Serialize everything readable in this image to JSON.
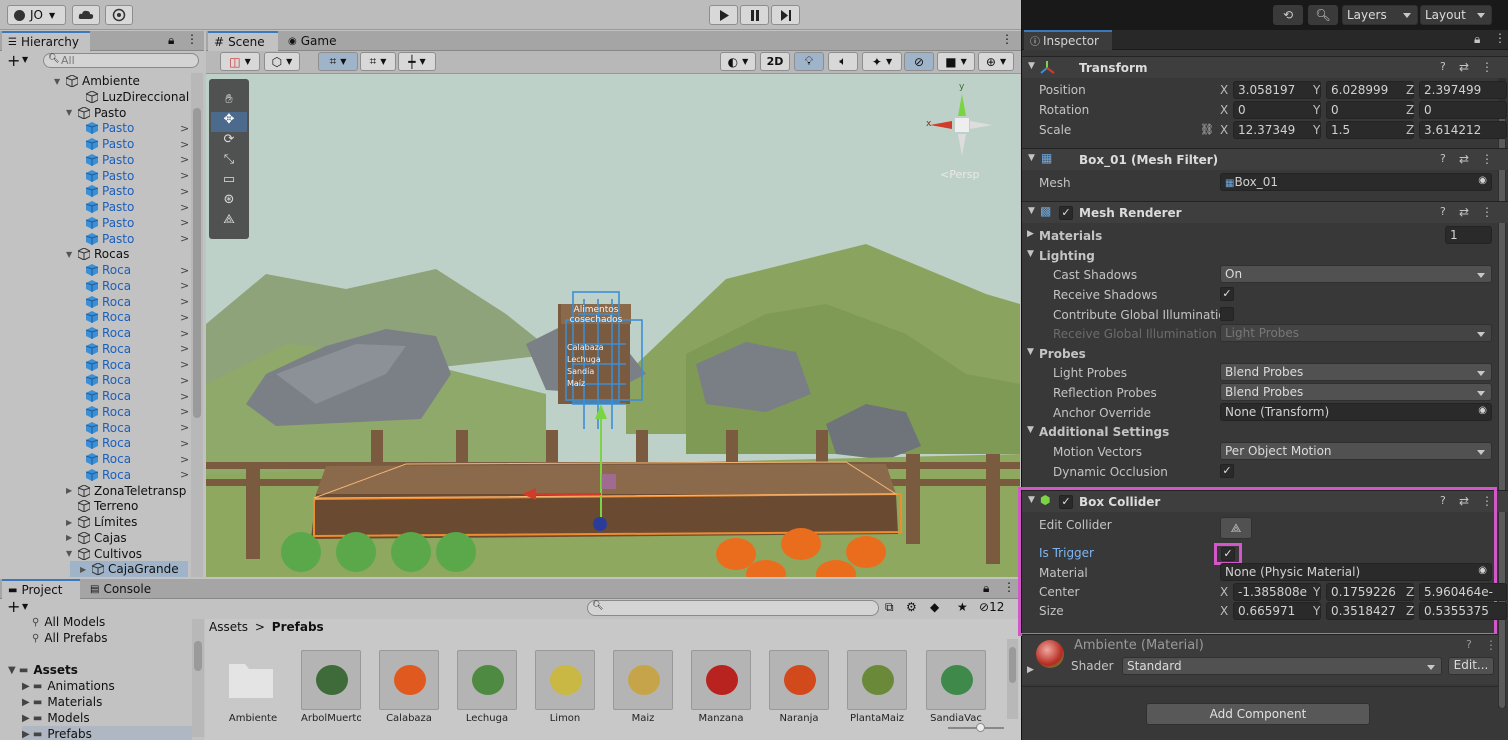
{
  "toolbar": {
    "account": "JO",
    "play_icon": "play-icon",
    "pause_icon": "pause-icon",
    "step_icon": "step-icon",
    "history_icon": "history-icon",
    "search_icon": "search-icon",
    "layers": "Layers",
    "layout": "Layout"
  },
  "hierarchy": {
    "tab": "Hierarchy",
    "search_placeholder": "All",
    "items": [
      {
        "label": "Ambiente",
        "blue": false
      },
      {
        "label": "LuzDireccional",
        "blue": false
      },
      {
        "label": "Pasto",
        "blue": false
      },
      {
        "label": "Pasto",
        "blue": true
      },
      {
        "label": "Pasto",
        "blue": true
      },
      {
        "label": "Pasto",
        "blue": true
      },
      {
        "label": "Pasto",
        "blue": true
      },
      {
        "label": "Pasto",
        "blue": true
      },
      {
        "label": "Pasto",
        "blue": true
      },
      {
        "label": "Pasto",
        "blue": true
      },
      {
        "label": "Pasto",
        "blue": true
      },
      {
        "label": "Rocas",
        "blue": false
      },
      {
        "label": "Roca",
        "blue": true
      },
      {
        "label": "Roca",
        "blue": true
      },
      {
        "label": "Roca",
        "blue": true
      },
      {
        "label": "Roca",
        "blue": true
      },
      {
        "label": "Roca",
        "blue": true
      },
      {
        "label": "Roca",
        "blue": true
      },
      {
        "label": "Roca",
        "blue": true
      },
      {
        "label": "Roca",
        "blue": true
      },
      {
        "label": "Roca",
        "blue": true
      },
      {
        "label": "Roca",
        "blue": true
      },
      {
        "label": "Roca",
        "blue": true
      },
      {
        "label": "Roca",
        "blue": true
      },
      {
        "label": "Roca",
        "blue": true
      },
      {
        "label": "Roca",
        "blue": true
      },
      {
        "label": "ZonaTeletransp",
        "blue": false
      },
      {
        "label": "Terreno",
        "blue": false
      },
      {
        "label": "Límites",
        "blue": false
      },
      {
        "label": "Cajas",
        "blue": false
      },
      {
        "label": "Cultivos",
        "blue": false
      },
      {
        "label": "CajaGrande",
        "blue": false
      }
    ]
  },
  "scene": {
    "tab_scene": "Scene",
    "tab_game": "Game",
    "mode_2d": "2D",
    "persp": "<Persp",
    "gizmo_x": "x",
    "gizmo_y": "y",
    "sign_lines": [
      "Alimentos",
      "cosechados",
      "Calabaza",
      "Lechuga",
      "Sandía",
      "Maíz"
    ]
  },
  "project": {
    "tab_project": "Project",
    "tab_console": "Console",
    "tree": [
      {
        "label": "All Models",
        "kind": "search"
      },
      {
        "label": "All Prefabs",
        "kind": "search"
      },
      {
        "label": "Assets",
        "kind": "root"
      },
      {
        "label": "Animations",
        "kind": "folder"
      },
      {
        "label": "Materials",
        "kind": "folder"
      },
      {
        "label": "Models",
        "kind": "folder"
      },
      {
        "label": "Prefabs",
        "kind": "folder"
      }
    ],
    "breadcrumb_root": "Assets",
    "breadcrumb_leaf": "Prefabs",
    "hidden_count": "12",
    "assets": [
      "Ambiente",
      "ArbolMuerto",
      "Calabaza",
      "Lechuga",
      "Limon",
      "Maiz",
      "Manzana",
      "Naranja",
      "PlantaMaiz",
      "SandiaVac"
    ]
  },
  "inspector": {
    "tab": "Inspector",
    "transform": {
      "title": "Transform",
      "position": {
        "label": "Position",
        "x": "3.058197",
        "y": "6.028999",
        "z": "2.397499"
      },
      "rotation": {
        "label": "Rotation",
        "x": "0",
        "y": "0",
        "z": "0"
      },
      "scale": {
        "label": "Scale",
        "x": "12.37349",
        "y": "1.5",
        "z": "3.614212"
      }
    },
    "mesh_filter": {
      "title": "Box_01 (Mesh Filter)",
      "mesh_label": "Mesh",
      "mesh_value": "Box_01"
    },
    "mesh_renderer": {
      "title": "Mesh Renderer",
      "materials_label": "Materials",
      "materials_count": "1",
      "lighting": "Lighting",
      "cast_shadows_label": "Cast Shadows",
      "cast_shadows": "On",
      "receive_shadows_label": "Receive Shadows",
      "contribute_gi_label": "Contribute Global Illumination",
      "receive_gi_label": "Receive Global Illumination",
      "receive_gi": "Light Probes",
      "probes": "Probes",
      "light_probes_label": "Light Probes",
      "light_probes": "Blend Probes",
      "reflection_probes_label": "Reflection Probes",
      "reflection_probes": "Blend Probes",
      "anchor_label": "Anchor Override",
      "anchor": "None (Transform)",
      "additional": "Additional Settings",
      "motion_label": "Motion Vectors",
      "motion": "Per Object Motion",
      "dynamic_label": "Dynamic Occlusion"
    },
    "box_collider": {
      "title": "Box Collider",
      "edit_label": "Edit Collider",
      "trigger_label": "Is Trigger",
      "material_label": "Material",
      "material": "None (Physic Material)",
      "center": {
        "label": "Center",
        "x": "-1.385808e",
        "y": "0.1759226",
        "z": "5.960464e-"
      },
      "size": {
        "label": "Size",
        "x": "0.665971",
        "y": "0.3518427",
        "z": "0.5355375"
      }
    },
    "material": {
      "title": "Ambiente (Material)",
      "shader_label": "Shader",
      "shader": "Standard",
      "edit": "Edit..."
    },
    "add_component": "Add Component",
    "axes": {
      "x": "X",
      "y": "Y",
      "z": "Z"
    }
  },
  "colors": {
    "highlight": "#d257c8",
    "selection_blue": "#3a8fd6",
    "inspector_bg": "#383838",
    "editor_bg": "#c2c2c2"
  }
}
